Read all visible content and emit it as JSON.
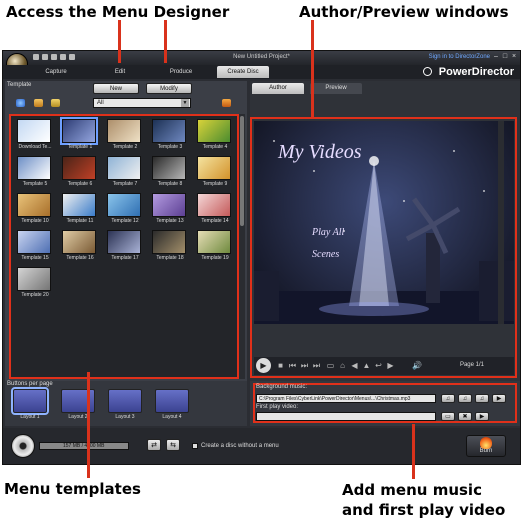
{
  "annotations": {
    "top_left": "Access the Menu Designer",
    "top_right": "Author/Preview windows",
    "bottom_left": "Menu templates",
    "bottom_right_line1": "Add menu music",
    "bottom_right_line2": "and first play video",
    "accent_color": "#d9321c"
  },
  "window": {
    "title": "New Untitled Project*",
    "signin": "Sign in to DirectorZone",
    "brand": "PowerDirector",
    "modes": [
      "Capture",
      "Edit",
      "Produce",
      "Create Disc"
    ],
    "active_mode": "Create Disc"
  },
  "template_panel": {
    "header": "Template",
    "new_button": "New",
    "modify_button": "Modify",
    "filter": "All",
    "templates": [
      {
        "label": "Download Te..."
      },
      {
        "label": "Template 1"
      },
      {
        "label": "Template 2"
      },
      {
        "label": "Template 3"
      },
      {
        "label": "Template 4"
      },
      {
        "label": "Template 5"
      },
      {
        "label": "Template 6"
      },
      {
        "label": "Template 7"
      },
      {
        "label": "Template 8"
      },
      {
        "label": "Template 9"
      },
      {
        "label": "Template 10"
      },
      {
        "label": "Template 11"
      },
      {
        "label": "Template 12"
      },
      {
        "label": "Template 13"
      },
      {
        "label": "Template 14"
      },
      {
        "label": "Template 15"
      },
      {
        "label": "Template 16"
      },
      {
        "label": "Template 17"
      },
      {
        "label": "Template 18"
      },
      {
        "label": "Template 19"
      },
      {
        "label": "Template 20"
      }
    ]
  },
  "preview_panel": {
    "tabs": [
      "Author",
      "Preview"
    ],
    "active_tab": "Author",
    "menu_title": "My Videos",
    "play_all": "Play All",
    "scenes": "Scenes",
    "page": "Page 1/1"
  },
  "buttons_per_page": {
    "header": "Buttons per page",
    "layouts": [
      "Layout 1",
      "Layout 2",
      "Layout 3",
      "Layout 4"
    ],
    "active": "Layout 1"
  },
  "music": {
    "background_label": "Background music:",
    "background_path": "C:\\Program Files\\CyberLink\\PowerDirector\\Menus\\...\\Christmas.mp3",
    "first_play_label": "First play video:",
    "first_play_value": ""
  },
  "bottom_bar": {
    "disc_space": "157 MB / 4700 MB",
    "no_menu_checkbox": "Create a disc without a menu",
    "burn_button": "Burn"
  }
}
